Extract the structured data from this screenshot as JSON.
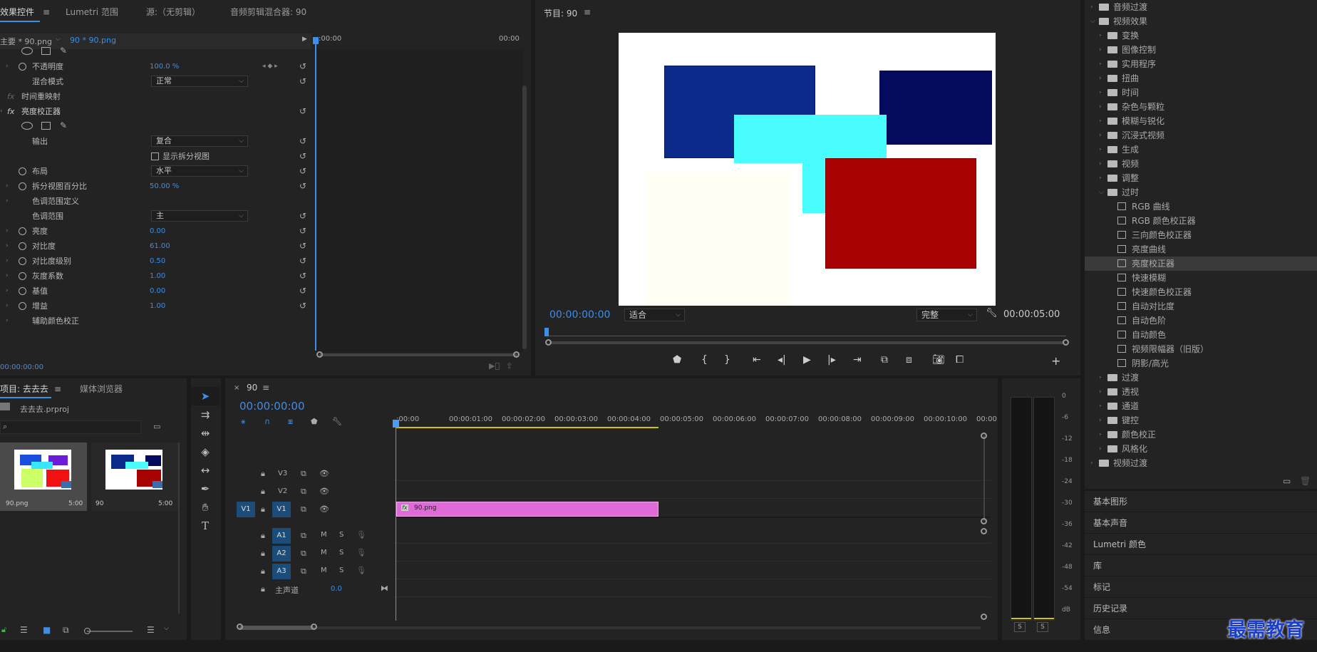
{
  "effect_controls": {
    "tabs": [
      "效果控件",
      "Lumetri 范围",
      "源:（无剪辑）",
      "音频剪辑混合器: 90"
    ],
    "master_clip": "主要 * 90.png",
    "seq_clip": "90 * 90.png",
    "timecodes": [
      ":00:00",
      "00:00"
    ],
    "rows": [
      {
        "label": "不透明度",
        "value": "100.0 %"
      },
      {
        "label": "混合模式",
        "dropdown": "正常"
      },
      {
        "label": "时间重映射"
      },
      {
        "label": "亮度校正器"
      },
      {
        "label": "输出",
        "dropdown": "复合"
      },
      {
        "label": "显示拆分视图"
      },
      {
        "label": "布局",
        "dropdown": "水平"
      },
      {
        "label": "拆分视图百分比",
        "value": "50.00 %"
      },
      {
        "label": "色调范围定义"
      },
      {
        "label": "色调范围",
        "dropdown": "主"
      },
      {
        "label": "亮度",
        "value": "0.00"
      },
      {
        "label": "对比度",
        "value": "61.00"
      },
      {
        "label": "对比度级别",
        "value": "0.50"
      },
      {
        "label": "灰度系数",
        "value": "1.00"
      },
      {
        "label": "基值",
        "value": "0.00"
      },
      {
        "label": "增益",
        "value": "1.00"
      },
      {
        "label": "辅助颜色校正"
      }
    ],
    "fx_label": "fx",
    "bottom_tc": "00:00:00:00"
  },
  "program": {
    "title": "节目: 90",
    "timecode": "00:00:00:00",
    "fit": "适合",
    "quality": "完整",
    "duration": "00:00:05:00"
  },
  "project": {
    "tabs": [
      "项目: 去去去",
      "媒体浏览器"
    ],
    "file": "去去去.prproj",
    "items": [
      {
        "name": "90.png",
        "dur": "5:00"
      },
      {
        "name": "90",
        "dur": "5:00"
      }
    ]
  },
  "timeline": {
    "title": "90",
    "timecode": "00:00:00:00",
    "ruler": [
      ":00:00",
      "00:00:01:00",
      "00:00:02:00",
      "00:00:03:00",
      "00:00:04:00",
      "00:00:05:00",
      "00:00:06:00",
      "00:00:07:00",
      "00:00:08:00",
      "00:00:09:00",
      "00:00:10:00",
      "00:00:1"
    ],
    "video_tracks": [
      "V3",
      "V2",
      "V1"
    ],
    "source_patch": "V1",
    "audio_tracks": [
      "A1",
      "A2",
      "A3"
    ],
    "mute": "M",
    "solo": "S",
    "master": "主声道",
    "master_val": "0.0",
    "clip_name": "90.png",
    "clip_fx": "fx"
  },
  "meter": {
    "scale": [
      "0",
      "-6",
      "-12",
      "-18",
      "-24",
      "-30",
      "-36",
      "-42",
      "-48",
      "-54",
      "dB"
    ],
    "solo": [
      "S",
      "S"
    ]
  },
  "effects_tree": [
    {
      "label": "音频过渡",
      "level": 0,
      "type": "folder",
      "open": false
    },
    {
      "label": "视频效果",
      "level": 0,
      "type": "folder",
      "open": true
    },
    {
      "label": "变换",
      "level": 1,
      "type": "folder"
    },
    {
      "label": "图像控制",
      "level": 1,
      "type": "folder"
    },
    {
      "label": "实用程序",
      "level": 1,
      "type": "folder"
    },
    {
      "label": "扭曲",
      "level": 1,
      "type": "folder"
    },
    {
      "label": "时间",
      "level": 1,
      "type": "folder"
    },
    {
      "label": "杂色与颗粒",
      "level": 1,
      "type": "folder"
    },
    {
      "label": "模糊与锐化",
      "level": 1,
      "type": "folder"
    },
    {
      "label": "沉浸式视频",
      "level": 1,
      "type": "folder"
    },
    {
      "label": "生成",
      "level": 1,
      "type": "folder"
    },
    {
      "label": "视频",
      "level": 1,
      "type": "folder"
    },
    {
      "label": "调整",
      "level": 1,
      "type": "folder"
    },
    {
      "label": "过时",
      "level": 1,
      "type": "folder",
      "open": true
    },
    {
      "label": "RGB 曲线",
      "level": 2,
      "type": "preset"
    },
    {
      "label": "RGB 颜色校正器",
      "level": 2,
      "type": "preset"
    },
    {
      "label": "三向颜色校正器",
      "level": 2,
      "type": "preset"
    },
    {
      "label": "亮度曲线",
      "level": 2,
      "type": "preset"
    },
    {
      "label": "亮度校正器",
      "level": 2,
      "type": "preset",
      "selected": true
    },
    {
      "label": "快速模糊",
      "level": 2,
      "type": "preset"
    },
    {
      "label": "快速颜色校正器",
      "level": 2,
      "type": "preset"
    },
    {
      "label": "自动对比度",
      "level": 2,
      "type": "preset"
    },
    {
      "label": "自动色阶",
      "level": 2,
      "type": "preset"
    },
    {
      "label": "自动颜色",
      "level": 2,
      "type": "preset"
    },
    {
      "label": "视频限幅器（旧版）",
      "level": 2,
      "type": "preset"
    },
    {
      "label": "阴影/高光",
      "level": 2,
      "type": "preset"
    },
    {
      "label": "过渡",
      "level": 1,
      "type": "folder"
    },
    {
      "label": "透视",
      "level": 1,
      "type": "folder"
    },
    {
      "label": "通道",
      "level": 1,
      "type": "folder"
    },
    {
      "label": "键控",
      "level": 1,
      "type": "folder"
    },
    {
      "label": "颜色校正",
      "level": 1,
      "type": "folder"
    },
    {
      "label": "风格化",
      "level": 1,
      "type": "folder"
    },
    {
      "label": "视频过渡",
      "level": 0,
      "type": "folder",
      "open": false
    }
  ],
  "right_panels": [
    "基本图形",
    "基本声音",
    "Lumetri 颜色",
    "库",
    "标记",
    "历史记录",
    "信息"
  ],
  "watermark": "最需教育",
  "colors": {
    "accent": "#3b8eea",
    "clip": "#e06ad8",
    "playhead": "#4a9aff"
  }
}
